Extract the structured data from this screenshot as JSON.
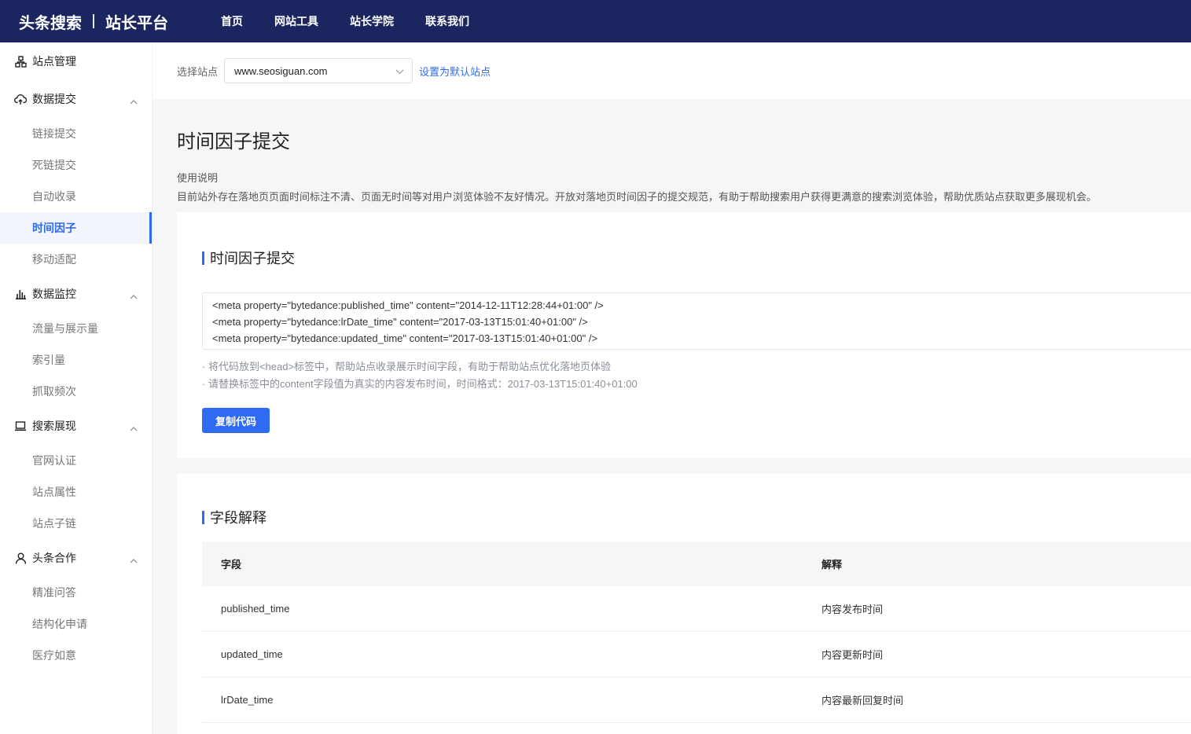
{
  "header": {
    "brand_left": "头条搜索",
    "brand_right": "站长平台",
    "nav": [
      "首页",
      "网站工具",
      "站长学院",
      "联系我们"
    ]
  },
  "sidebar": {
    "site_mgmt": "站点管理",
    "groups": [
      {
        "label": "数据提交",
        "items": [
          "链接提交",
          "死链提交",
          "自动收录",
          "时间因子",
          "移动适配"
        ]
      },
      {
        "label": "数据监控",
        "items": [
          "流量与展示量",
          "索引量",
          "抓取频次"
        ]
      },
      {
        "label": "搜索展现",
        "items": [
          "官网认证",
          "站点属性",
          "站点子链"
        ]
      },
      {
        "label": "头条合作",
        "items": [
          "精准问答",
          "结构化申请",
          "医疗如意"
        ]
      }
    ],
    "active_item": "时间因子"
  },
  "site_selector": {
    "label": "选择站点",
    "value": "www.seosiguan.com",
    "set_default": "设置为默认站点"
  },
  "page": {
    "title": "时间因子提交",
    "usage_label": "使用说明",
    "usage_desc": "目前站外存在落地页页面时间标注不清、页面无时间等对用户浏览体验不友好情况。开放对落地页时间因子的提交规范，有助于帮助搜索用户获得更满意的搜索浏览体验，帮助优质站点获取更多展现机会。"
  },
  "submit_card": {
    "title": "时间因子提交",
    "code_lines": [
      "<meta property=\"bytedance:published_time\" content=\"2014-12-11T12:28:44+01:00\" />",
      "<meta property=\"bytedance:lrDate_time\" content=\"2017-03-13T15:01:40+01:00\" />",
      "<meta property=\"bytedance:updated_time\" content=\"2017-03-13T15:01:40+01:00\" />"
    ],
    "tips": [
      "· 将代码放到<head>标签中，帮助站点收录展示时间字段，有助于帮助站点优化落地页体验",
      "· 请替换标签中的content字段值为真实的内容发布时间，时间格式：2017-03-13T15:01:40+01:00"
    ],
    "copy_button": "复制代码"
  },
  "fields_card": {
    "title": "字段解释",
    "headers": [
      "字段",
      "解释"
    ],
    "rows": [
      [
        "published_time",
        "内容发布时间"
      ],
      [
        "updated_time",
        "内容更新时间"
      ],
      [
        "lrDate_time",
        "内容最新回复时间"
      ]
    ]
  },
  "colors": {
    "topbar": "#1b2660",
    "accent": "#2f6bf2"
  },
  "icons": {
    "site_mgmt": "sitemap-icon",
    "data_submit": "cloud-upload-icon",
    "data_monitor": "bar-chart-icon",
    "search_display": "laptop-icon",
    "toutiao_coop": "user-icon"
  }
}
